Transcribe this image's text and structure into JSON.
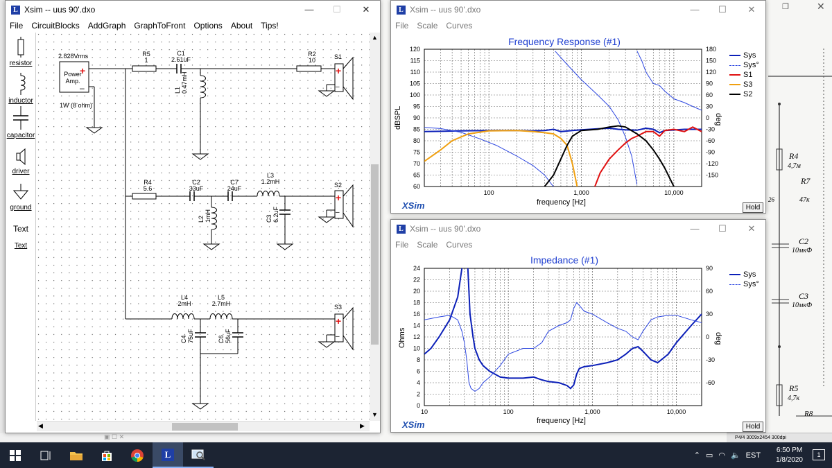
{
  "circuit": {
    "title": "Xsim -- uus 90'.dxo",
    "menus": [
      "File",
      "CircuitBlocks",
      "AddGraph",
      "GraphToFront",
      "Options",
      "About",
      "Tips!"
    ],
    "tools": [
      {
        "label": "resistor",
        "icon": "resistor-icon"
      },
      {
        "label": "inductor",
        "icon": "inductor-icon"
      },
      {
        "label": "capacitor",
        "icon": "capacitor-icon"
      },
      {
        "label": "driver",
        "icon": "driver-icon"
      },
      {
        "label": "ground",
        "icon": "ground-icon"
      },
      {
        "label": "Text",
        "icon": ""
      },
      {
        "label": "Text",
        "icon": ""
      }
    ],
    "amp": {
      "label1": "Power",
      "label2": "Amp.",
      "voltage": "2.828Vrms",
      "load": "1W (8 ohm)"
    },
    "components": [
      {
        "id": "R5",
        "value": "1"
      },
      {
        "id": "C1",
        "value": "2.61uF"
      },
      {
        "id": "L1",
        "value": "0.47mH"
      },
      {
        "id": "R2",
        "value": "10"
      },
      {
        "id": "S1",
        "value": ""
      },
      {
        "id": "R4",
        "value": "5.6"
      },
      {
        "id": "C2",
        "value": "33uF"
      },
      {
        "id": "C7",
        "value": "24uF"
      },
      {
        "id": "L3",
        "value": "1.2mH"
      },
      {
        "id": "L2",
        "value": "1mH"
      },
      {
        "id": "C3",
        "value": "6.2uF"
      },
      {
        "id": "S2",
        "value": ""
      },
      {
        "id": "L4",
        "value": "2mH"
      },
      {
        "id": "L5",
        "value": "2.7mH"
      },
      {
        "id": "C4",
        "value": "75uF"
      },
      {
        "id": "C6",
        "value": "56uF"
      },
      {
        "id": "S3",
        "value": ""
      }
    ]
  },
  "freq": {
    "title": "Xsim -- uus 90'.dxo",
    "menus": [
      "File",
      "Scale",
      "Curves"
    ],
    "hold": "Hold",
    "brand": "XSim",
    "chart_data": {
      "type": "line",
      "title": "Frequency Response (#1)",
      "xlabel": "frequency [Hz]",
      "ylabel": "dBSPL",
      "y2label": "deg",
      "xscale": "log",
      "xlim": [
        20,
        20000
      ],
      "ylim": [
        60,
        120
      ],
      "y2lim": [
        -180,
        180
      ],
      "xticks": [
        {
          "v": 100,
          "l": "100"
        },
        {
          "v": 1000,
          "l": "1,000"
        },
        {
          "v": 10000,
          "l": "10,000"
        }
      ],
      "yticks": [
        60,
        65,
        70,
        75,
        80,
        85,
        90,
        95,
        100,
        105,
        110,
        115,
        120
      ],
      "y2ticks": [
        -150,
        -120,
        -90,
        -60,
        -30,
        0,
        30,
        60,
        90,
        120,
        150,
        180
      ],
      "grid": true,
      "legend": "top-right",
      "series": [
        {
          "name": "Sys",
          "color": "#0b1fb8",
          "width": 2,
          "dash": "",
          "axis": "y",
          "x": [
            20,
            50,
            100,
            200,
            300,
            400,
            500,
            600,
            800,
            1000,
            1500,
            2000,
            2500,
            3000,
            4000,
            5000,
            6000,
            7000,
            8000,
            10000,
            13000,
            16000,
            20000
          ],
          "y": [
            84,
            84.3,
            84.5,
            84.5,
            84.3,
            84.5,
            85,
            84,
            84.5,
            84.8,
            85.2,
            85.5,
            85,
            84.8,
            84.6,
            85.5,
            85,
            83.5,
            84.5,
            84.7,
            85,
            85,
            85
          ]
        },
        {
          "name": "Sys°",
          "color": "#2c46e0",
          "width": 1,
          "dash": "",
          "axis": "y2",
          "x": [
            20,
            30,
            50,
            80,
            120,
            200,
            300,
            400,
            480,
            500,
            520,
            700,
            1000,
            1500,
            2000,
            2500,
            3000,
            3500,
            3990,
            4010,
            4500,
            5000,
            6000,
            7000,
            8000,
            10000,
            13000,
            16000,
            20000
          ],
          "y": [
            -25,
            -28,
            -38,
            -55,
            -72,
            -100,
            -125,
            -150,
            -175,
            -180,
            175,
            140,
            100,
            60,
            30,
            -5,
            -50,
            -100,
            -175,
            175,
            150,
            120,
            90,
            85,
            70,
            50,
            40,
            30,
            20
          ]
        },
        {
          "name": "S1",
          "color": "#e01010",
          "width": 2,
          "dash": "",
          "axis": "y",
          "x": [
            1400,
            1600,
            2000,
            2500,
            3000,
            3500,
            4000,
            5000,
            6000,
            7000,
            8000,
            10000,
            13000,
            16000,
            20000
          ],
          "y": [
            60,
            66,
            72,
            76,
            79,
            81,
            82,
            84,
            84,
            82,
            84.5,
            85,
            84,
            86,
            84
          ]
        },
        {
          "name": "S3",
          "color": "#f0a010",
          "width": 2,
          "dash": "",
          "axis": "y",
          "x": [
            20,
            30,
            40,
            60,
            100,
            200,
            300,
            400,
            500,
            600,
            700,
            800,
            900
          ],
          "y": [
            71,
            76,
            80,
            83,
            84.3,
            84.5,
            84,
            83.5,
            83,
            81,
            78,
            70,
            60
          ]
        },
        {
          "name": "S2",
          "color": "#000000",
          "width": 2,
          "dash": "",
          "axis": "y",
          "x": [
            400,
            500,
            600,
            700,
            800,
            1000,
            1500,
            2000,
            2500,
            3000,
            4000,
            5000,
            6000,
            7000,
            8000,
            10000
          ],
          "y": [
            60,
            65,
            72,
            78,
            82,
            84.5,
            85,
            86,
            86.5,
            86,
            83,
            80,
            76,
            72,
            68,
            60
          ]
        }
      ]
    }
  },
  "imp": {
    "title": "Xsim -- uus 90'.dxo",
    "menus": [
      "File",
      "Scale",
      "Curves"
    ],
    "hold": "Hold",
    "brand": "XSim",
    "chart_data": {
      "type": "line",
      "title": "Impedance (#1)",
      "xlabel": "frequency [Hz]",
      "ylabel": "Ohms",
      "y2label": "deg",
      "xscale": "log",
      "xlim": [
        10,
        20000
      ],
      "ylim": [
        0,
        24
      ],
      "y2lim": [
        -90,
        90
      ],
      "xticks": [
        {
          "v": 10,
          "l": "10"
        },
        {
          "v": 100,
          "l": "100"
        },
        {
          "v": 1000,
          "l": "1,000"
        },
        {
          "v": 10000,
          "l": "10,000"
        }
      ],
      "yticks": [
        0,
        2,
        4,
        6,
        8,
        10,
        12,
        14,
        16,
        18,
        20,
        22,
        24
      ],
      "y2ticks": [
        -60,
        -30,
        0,
        30,
        60,
        90
      ],
      "grid": true,
      "legend": "top-right",
      "series": [
        {
          "name": "Sys",
          "color": "#0b1fb8",
          "width": 2,
          "dash": "",
          "axis": "y",
          "x": [
            10,
            12,
            15,
            20,
            25,
            28,
            30,
            33,
            35,
            38,
            40,
            45,
            50,
            60,
            80,
            100,
            150,
            200,
            250,
            300,
            400,
            500,
            550,
            600,
            650,
            700,
            800,
            1000,
            1500,
            2000,
            2500,
            3000,
            3500,
            4000,
            5000,
            6000,
            8000,
            10000,
            15000,
            20000
          ],
          "y": [
            9,
            10,
            12,
            15,
            19,
            24,
            25,
            24,
            16,
            12,
            10,
            8,
            7,
            6,
            5,
            4.8,
            4.8,
            5,
            4.5,
            4.2,
            4,
            3.5,
            3,
            3.6,
            5.5,
            6.5,
            6.8,
            7,
            7.5,
            8,
            9,
            10,
            10.3,
            9.5,
            8,
            7.5,
            9,
            11,
            14,
            16
          ]
        },
        {
          "name": "Sys°",
          "color": "#2c46e0",
          "width": 1,
          "dash": "",
          "axis": "y",
          "x": [
            10,
            15,
            20,
            25,
            28,
            30,
            32,
            34,
            36,
            40,
            45,
            50,
            60,
            80,
            100,
            150,
            200,
            250,
            300,
            400,
            500,
            550,
            600,
            650,
            700,
            800,
            1000,
            1500,
            2000,
            2500,
            3000,
            3500,
            4000,
            5000,
            6000,
            8000,
            10000,
            15000,
            20000
          ],
          "y": [
            15,
            15.5,
            15.8,
            15,
            13,
            11,
            8,
            4,
            3,
            2.5,
            3,
            4,
            5,
            7,
            9,
            10,
            10,
            11,
            13,
            14,
            14.5,
            15,
            17,
            18,
            17.5,
            16.5,
            16,
            14.5,
            13.5,
            13,
            12,
            11.5,
            13,
            15,
            15.5,
            15.8,
            15.8,
            15,
            14.5
          ]
        }
      ]
    }
  },
  "bgdoc": {
    "labels": [
      "R4",
      "4,7м",
      "R7",
      "47к",
      "С2",
      "10мкФ",
      "С3",
      "10мкФ",
      "R5",
      "4,7к",
      "R8",
      "26"
    ],
    "status": "P4/4  3009x2454 300dpi"
  },
  "taskbar": {
    "lang": "EST",
    "time": "6:50 PM",
    "date": "1/8/2020",
    "notif_count": "1"
  },
  "desktop_icon": "restore-icon"
}
